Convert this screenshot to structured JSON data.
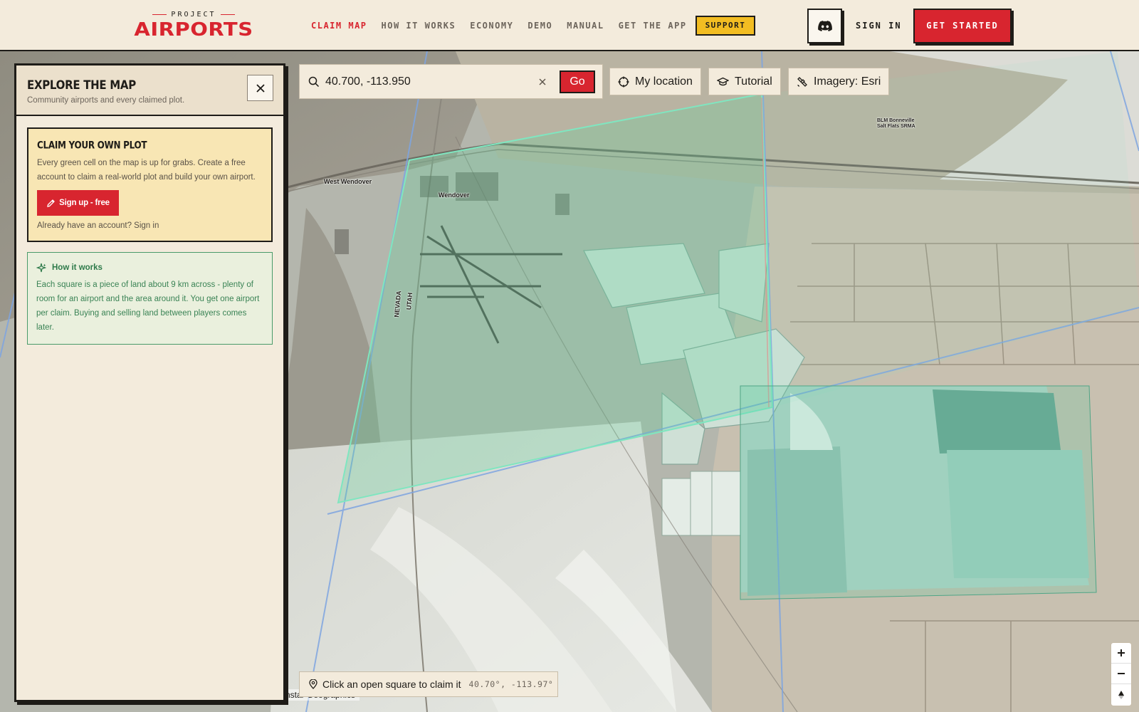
{
  "brand": {
    "small_text": "PROJECT",
    "name": "AIRPORTS",
    "accent_color": "#d8252f"
  },
  "nav": {
    "items": [
      {
        "label": "CLAIM MAP",
        "active": true
      },
      {
        "label": "HOW IT WORKS",
        "active": false
      },
      {
        "label": "ECONOMY",
        "active": false
      },
      {
        "label": "DEMO",
        "active": false
      },
      {
        "label": "MANUAL",
        "active": false
      },
      {
        "label": "GET THE APP",
        "active": false
      }
    ],
    "support_label": "SUPPORT",
    "discord_icon": "discord-icon",
    "signin_label": "SIGN IN",
    "get_started_label": "GET STARTED"
  },
  "panel": {
    "title": "EXPLORE THE MAP",
    "subtitle": "Community airports and every claimed plot.",
    "close_icon": "close-icon",
    "claim": {
      "title": "CLAIM YOUR OWN PLOT",
      "text": "Every green cell on the map is up for grabs. Create a free account to claim a real-world plot and build your own airport.",
      "button_label": "Sign up - free",
      "button_icon": "pencil-icon",
      "footer": "Already have an account? Sign in"
    },
    "how": {
      "title": "How it works",
      "icon": "sparkle-icon",
      "text": "Each square is a piece of land about 9 km across - plenty of room for an airport and the area around it. You get one airport per claim. Buying and selling land between players comes later."
    }
  },
  "search": {
    "value": "40.700, -113.950",
    "go_label": "Go"
  },
  "toolbar": {
    "my_location_label": "My location",
    "tutorial_label": "Tutorial",
    "imagery_label": "Imagery: Esri"
  },
  "map": {
    "labels": {
      "west_wendover": "West Wendover",
      "wendover": "Wendover",
      "nevada": "NEVADA",
      "utah": "UTAH",
      "blm_line1": "BLM Bonneville",
      "blm_line2": "Salt Flats SRMA"
    },
    "status_text": "Click an open square to claim it",
    "status_coords": "40.70°, -113.97°",
    "attribution": "nstar Geographics",
    "claim_cell_color": "#5fd39a"
  },
  "zoom": {
    "zoom_in": "+",
    "zoom_out": "−",
    "compass": "▲"
  }
}
